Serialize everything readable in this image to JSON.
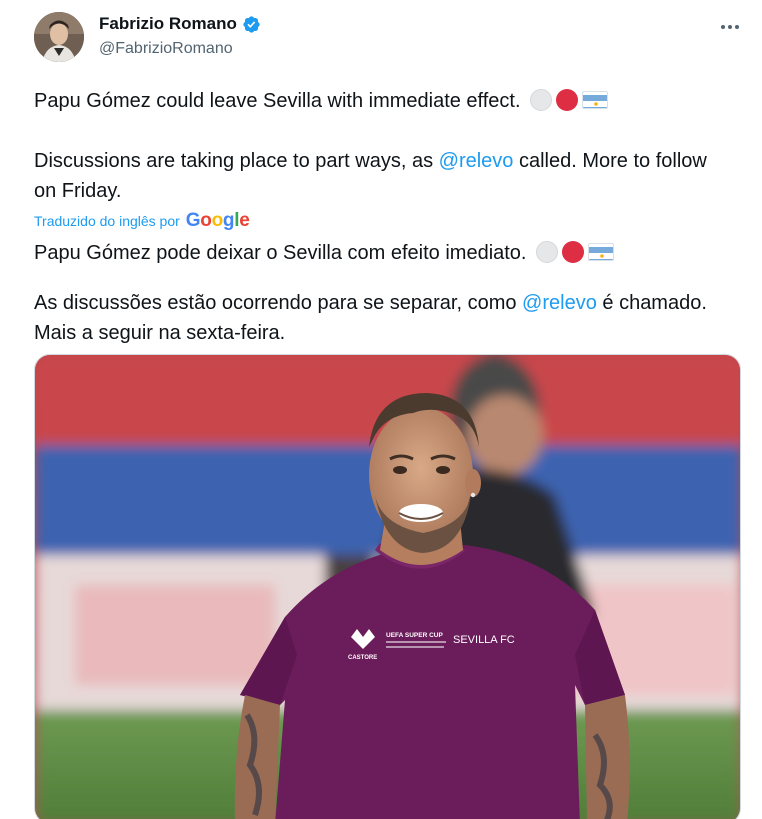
{
  "author": {
    "display_name": "Fabrizio Romano",
    "handle": "@FabrizioRomano",
    "avatar_icon": "profile-photo",
    "verified_icon": "verified-badge-icon",
    "verified_color": "#1d9bf0"
  },
  "menu_icon": "more-horizontal-icon",
  "tweet": {
    "line1": "Papu Gómez could leave Sevilla with immediate effect.",
    "line2_a": "Discussions are taking place to part ways, as ",
    "line2_mention": "@relevo",
    "line2_b": " called. More to follow on Friday.",
    "emojis": [
      "white-circle",
      "red-circle",
      "argentina-flag"
    ]
  },
  "translation": {
    "label": "Traduzido do inglês por",
    "provider": "Google",
    "line1": "Papu Gómez pode deixar o Sevilla com efeito imediato.",
    "line2_a": "As discussões estão ocorrendo para se separar, como ",
    "line2_mention": "@relevo",
    "line2_b": " é chamado. Mais a seguir na sexta-feira."
  },
  "media": {
    "shirt_text": "SEVILLA FC",
    "sponsor_text": "CASTORE",
    "patch_text": "UEFA SUPER CUP"
  },
  "colors": {
    "link": "#1d9bf0",
    "text": "#0f1419",
    "secondary": "#536471",
    "shirt": "#6b1c5a"
  }
}
